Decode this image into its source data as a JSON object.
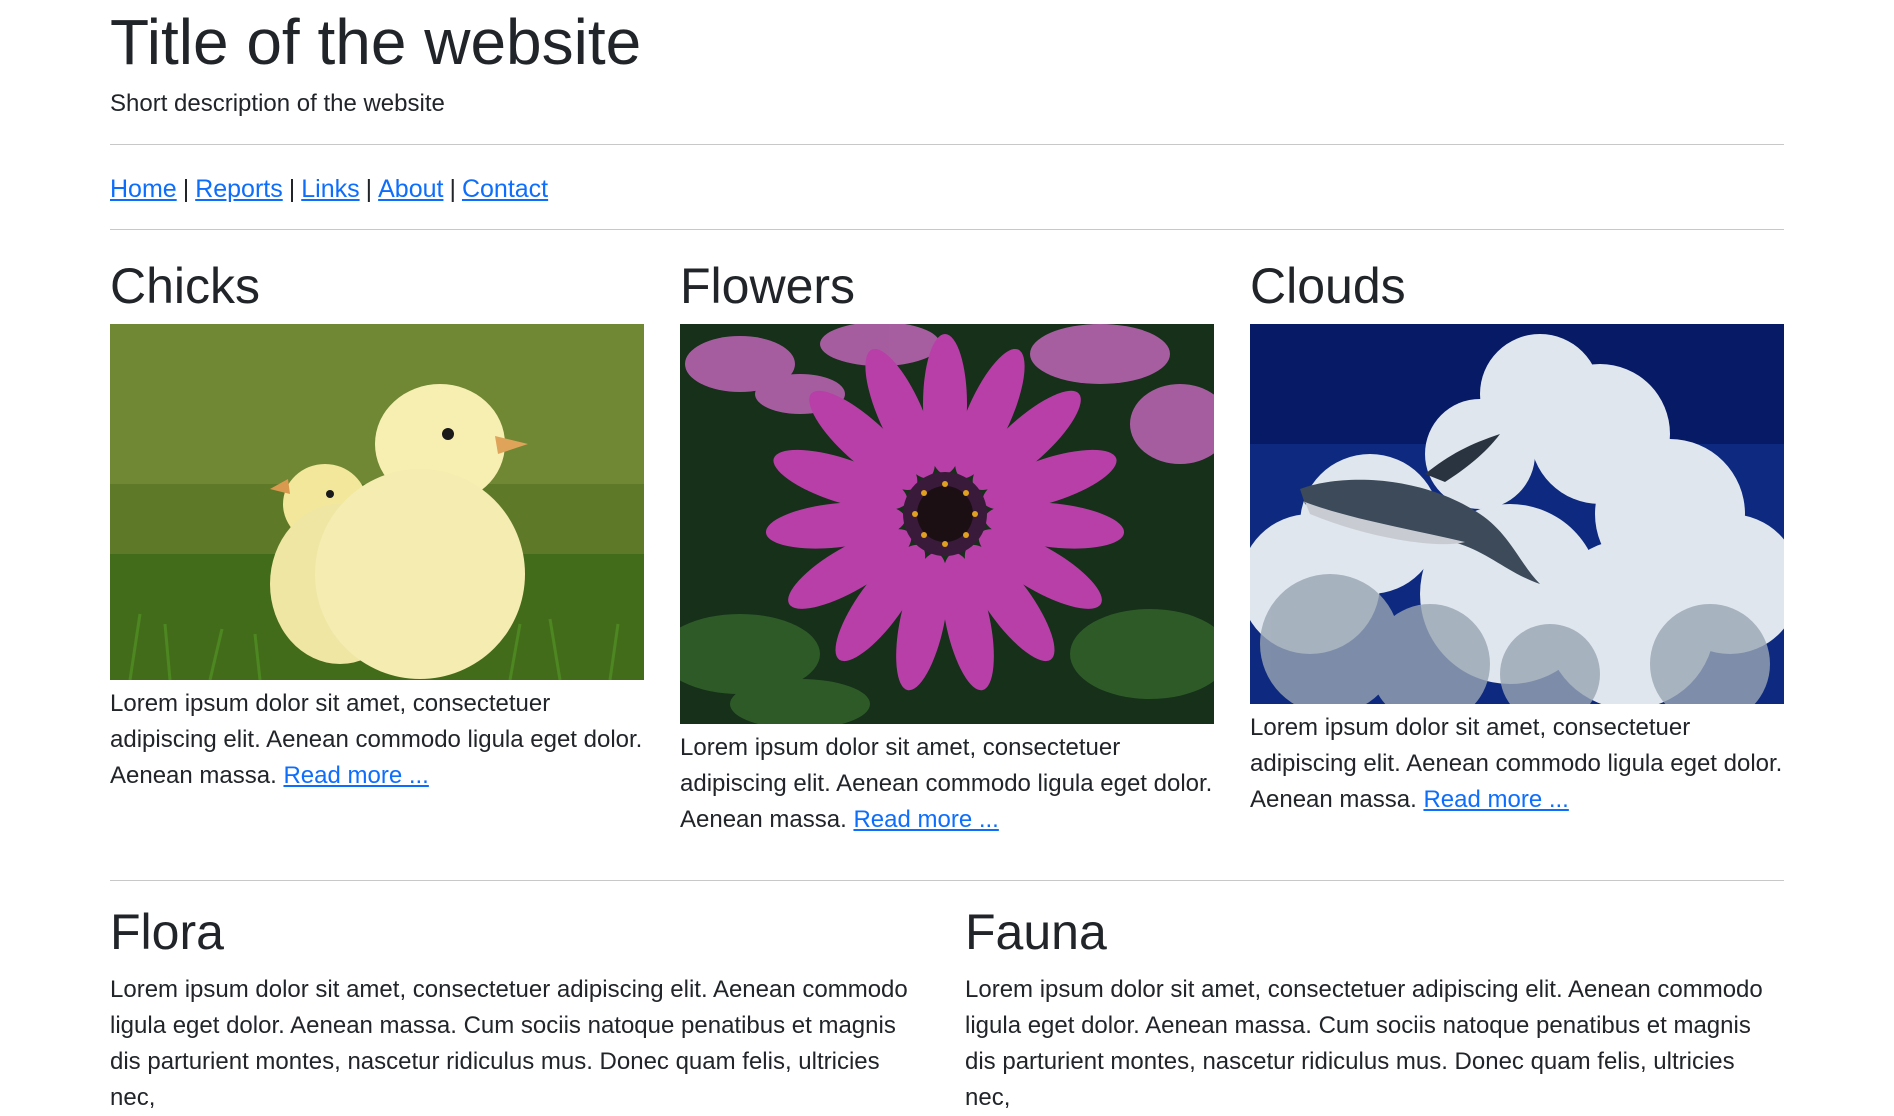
{
  "header": {
    "title": "Title of the website",
    "description": "Short description of the website"
  },
  "nav": {
    "links": [
      "Home",
      "Reports",
      "Links",
      "About",
      "Contact"
    ],
    "separator": "|"
  },
  "cards": [
    {
      "title": "Chicks",
      "text": "Lorem ipsum dolor sit amet, consectetuer adipiscing elit. Aenean commodo ligula eget dolor. Aenean massa.",
      "link": "Read more ..."
    },
    {
      "title": "Flowers",
      "text": "Lorem ipsum dolor sit amet, consectetuer adipiscing elit. Aenean commodo ligula eget dolor. Aenean massa.",
      "link": "Read more ..."
    },
    {
      "title": "Clouds",
      "text": "Lorem ipsum dolor sit amet, consectetuer adipiscing elit. Aenean commodo ligula eget dolor. Aenean massa.",
      "link": "Read more ..."
    }
  ],
  "sections": [
    {
      "title": "Flora",
      "text": "Lorem ipsum dolor sit amet, consectetuer adipiscing elit. Aenean commodo ligula eget dolor. Aenean massa. Cum sociis natoque penatibus et magnis dis parturient montes, nascetur ridiculus mus. Donec quam felis, ultricies nec,"
    },
    {
      "title": "Fauna",
      "text": "Lorem ipsum dolor sit amet, consectetuer adipiscing elit. Aenean commodo ligula eget dolor. Aenean massa. Cum sociis natoque penatibus et magnis dis parturient montes, nascetur ridiculus mus. Donec quam felis, ultricies nec,"
    }
  ],
  "colors": {
    "link": "#0d6efd",
    "text": "#212529",
    "rule": "#c8c8c8"
  }
}
